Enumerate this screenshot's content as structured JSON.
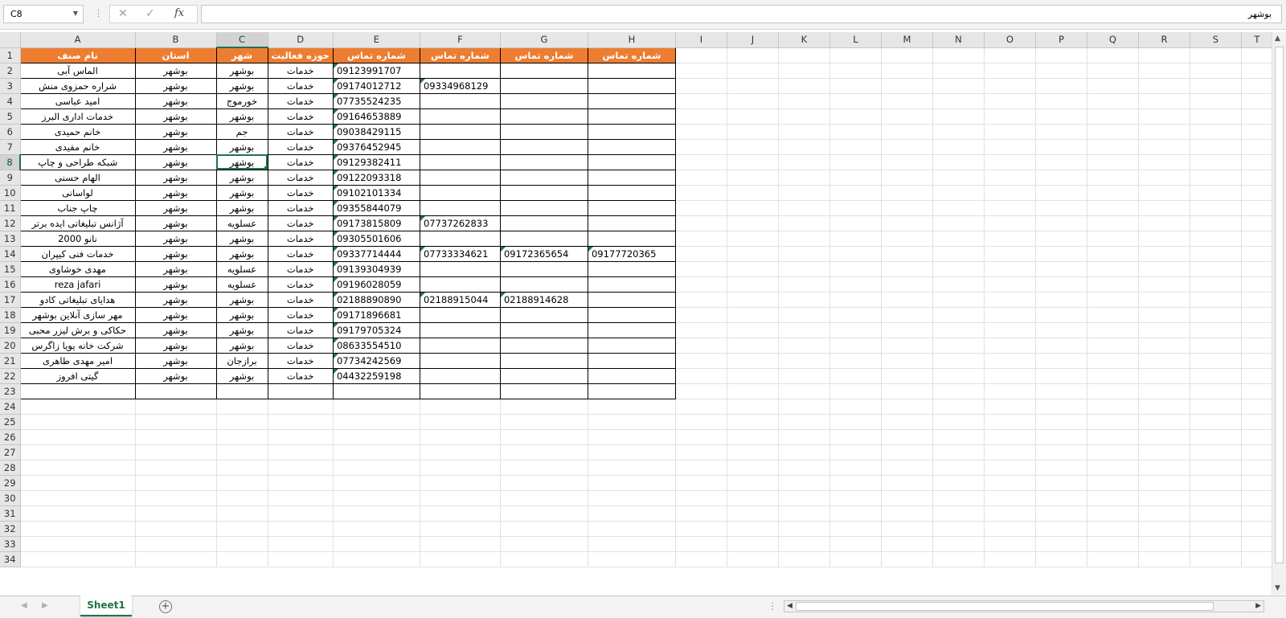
{
  "name_box": "C8",
  "formula_bar": {
    "cancel_icon": "✕",
    "enter_icon": "✓",
    "fx_label": "fx",
    "value": "بوشهر"
  },
  "columns": [
    "A",
    "B",
    "C",
    "D",
    "E",
    "F",
    "G",
    "H",
    "I",
    "J",
    "K",
    "L",
    "M",
    "N",
    "O",
    "P",
    "Q",
    "R",
    "S",
    "T"
  ],
  "selected_column": "C",
  "selected_row": 8,
  "table_headers": [
    "نام صنف",
    "استان",
    "شهر",
    "حوزه فعالیت",
    "شماره تماس",
    "شماره تماس",
    "شماره تماس",
    "شماره تماس"
  ],
  "rows": [
    [
      "الماس آبی",
      "بوشهر",
      "بوشهر",
      "خدمات",
      "09123991707",
      "",
      "",
      ""
    ],
    [
      "شراره حمزوی منش",
      "بوشهر",
      "بوشهر",
      "خدمات",
      "09174012712",
      "09334968129",
      "",
      ""
    ],
    [
      "امید عباسی",
      "بوشهر",
      "خورموج",
      "خدمات",
      "07735524235",
      "",
      "",
      ""
    ],
    [
      "خدمات اداری البرز",
      "بوشهر",
      "بوشهر",
      "خدمات",
      "09164653889",
      "",
      "",
      ""
    ],
    [
      "خانم حمیدی",
      "بوشهر",
      "جم",
      "خدمات",
      "09038429115",
      "",
      "",
      ""
    ],
    [
      "خانم مفیدی",
      "بوشهر",
      "بوشهر",
      "خدمات",
      "09376452945",
      "",
      "",
      ""
    ],
    [
      "شبکه طراحی و چاپ",
      "بوشهر",
      "بوشهر",
      "خدمات",
      "09129382411",
      "",
      "",
      ""
    ],
    [
      "الهام حسنی",
      "بوشهر",
      "بوشهر",
      "خدمات",
      "09122093318",
      "",
      "",
      ""
    ],
    [
      "لواسانی",
      "بوشهر",
      "بوشهر",
      "خدمات",
      "09102101334",
      "",
      "",
      ""
    ],
    [
      "چاپ جناب",
      "بوشهر",
      "بوشهر",
      "خدمات",
      "09355844079",
      "",
      "",
      ""
    ],
    [
      "آژانس تبلیغاتی ایده برتر",
      "بوشهر",
      "عسلویه",
      "خدمات",
      "09173815809",
      "07737262833",
      "",
      ""
    ],
    [
      "نانو 2000",
      "بوشهر",
      "بوشهر",
      "خدمات",
      "09305501606",
      "",
      "",
      ""
    ],
    [
      "خدمات فنی کیپران",
      "بوشهر",
      "بوشهر",
      "خدمات",
      "09337714444",
      "07733334621",
      "09172365654",
      "09177720365"
    ],
    [
      "مهدی خوشاوی",
      "بوشهر",
      "عسلویه",
      "خدمات",
      "09139304939",
      "",
      "",
      ""
    ],
    [
      "reza jafari",
      "بوشهر",
      "عسلویه",
      "خدمات",
      "09196028059",
      "",
      "",
      ""
    ],
    [
      "هدایای تبلیغاتی کادو",
      "بوشهر",
      "بوشهر",
      "خدمات",
      "02188890890",
      "02188915044",
      "02188914628",
      ""
    ],
    [
      "مهر سازی آنلاین بوشهر",
      "بوشهر",
      "بوشهر",
      "خدمات",
      "09171896681",
      "",
      "",
      ""
    ],
    [
      "حکاکی و برش لیزر محبی",
      "بوشهر",
      "بوشهر",
      "خدمات",
      "09179705324",
      "",
      "",
      ""
    ],
    [
      "شرکت خانه پویا زاگرس",
      "بوشهر",
      "بوشهر",
      "خدمات",
      "08633554510",
      "",
      "",
      ""
    ],
    [
      "امیر مهدی طاهری",
      "بوشهر",
      "برازجان",
      "خدمات",
      "07734242569",
      "",
      "",
      ""
    ],
    [
      "گیتی افروز",
      "بوشهر",
      "بوشهر",
      "خدمات",
      "04432259198",
      "",
      "",
      ""
    ]
  ],
  "total_rows": 34,
  "sheet_tab": "Sheet1",
  "add_sheet_icon": "+"
}
